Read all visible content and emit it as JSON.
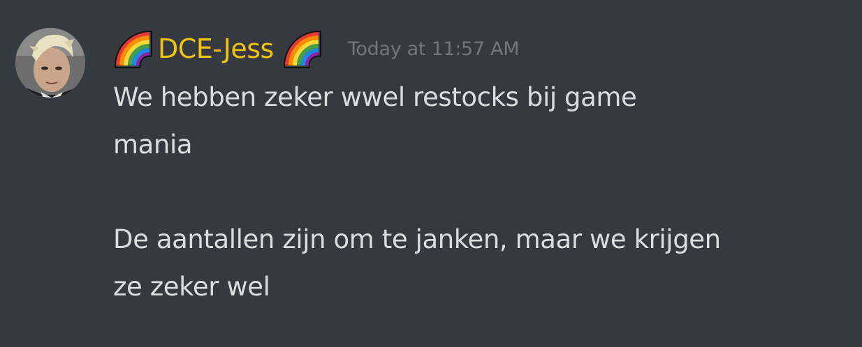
{
  "message": {
    "author": {
      "name": "DCE-Jess",
      "name_color": "#f1c40f",
      "decoration_left_icon": "rainbow-emoji-icon",
      "decoration_right_icon": "rainbow-emoji-icon"
    },
    "timestamp": "Today at 11:57 AM",
    "paragraphs": [
      [
        "We hebben zeker wwel restocks bij game",
        "mania"
      ],
      [
        "De aantallen zijn om te janken, maar we krijgen",
        "ze zeker wel"
      ]
    ]
  },
  "colors": {
    "background": "#36393f",
    "text": "#dcddde",
    "timestamp": "#72767d"
  }
}
